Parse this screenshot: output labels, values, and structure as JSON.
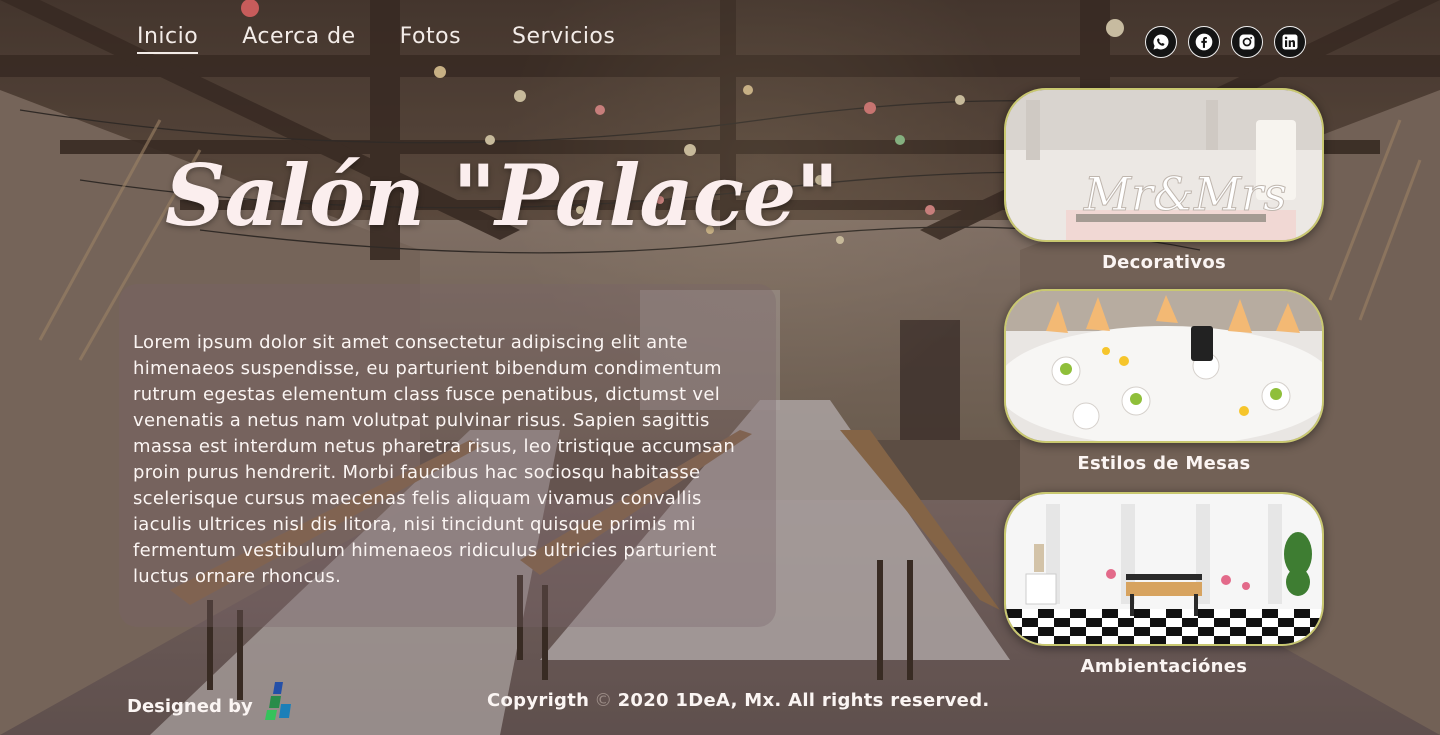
{
  "nav": {
    "items": [
      {
        "label": "Inicio",
        "active": true
      },
      {
        "label": "Acerca de",
        "active": false
      },
      {
        "label": "Fotos",
        "active": false
      },
      {
        "label": "Servicios",
        "active": false
      }
    ],
    "social_icons": [
      "whatsapp-icon",
      "facebook-icon",
      "instagram-icon",
      "linkedin-icon"
    ]
  },
  "hero": {
    "title": "Salón \"Palace\"",
    "description": "Lorem ipsum dolor sit amet consectetur adipiscing elit ante himenaeos suspendisse, eu parturient bibendum condimentum rutrum egestas elementum class fusce penatibus, dictumst vel venenatis a netus nam volutpat pulvinar risus. Sapien sagittis massa est interdum netus pharetra risus, leo tristique accumsan proin purus hendrerit. Morbi faucibus hac sociosqu habitasse scelerisque cursus maecenas felis aliquam vivamus convallis iaculis ultrices nisl dis litora, nisi tincidunt quisque primis mi fermentum vestibulum himenaeos ridiculus ultricies parturient luctus ornare rhoncus."
  },
  "cards": [
    {
      "label": "Decorativos",
      "image_text": "Mr&Mrs"
    },
    {
      "label": "Estilos de Mesas"
    },
    {
      "label": "Ambientaciónes"
    }
  ],
  "footer": {
    "designed_by": "Designed by",
    "copyright_prefix": "Copyrigth",
    "copyright_symbol": "©",
    "copyright_text": "2020 1DeA, Mx. All rights reserved."
  },
  "colors": {
    "card_border": "#c9c870",
    "text": "#fbf5f3"
  }
}
